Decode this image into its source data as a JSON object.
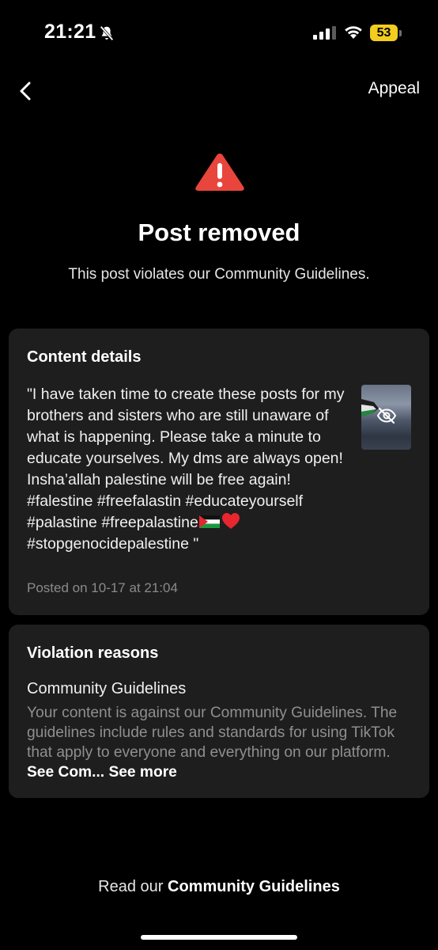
{
  "status_bar": {
    "time": "21:21",
    "battery_level": "53",
    "battery_color": "#f2cc1f"
  },
  "nav": {
    "back_icon": "chevron-left-icon",
    "appeal_label": "Appeal"
  },
  "header": {
    "icon": "warning-triangle-icon",
    "icon_color": "#e8453c",
    "title": "Post removed",
    "subtitle": "This post violates our Community Guidelines."
  },
  "content_details": {
    "title": "Content details",
    "post_text": "\"I have taken time to create these posts for my brothers and sisters who are still unaware of what is happening. Please take a minute to educate yourselves. My dms are always open! Insha’allah palestine will be free again! #falestine #freefalastin #educateyourself #palastine #freepalastine",
    "post_text_end": "#stopgenocidepalestine \"",
    "emojis": [
      "palestine-flag-icon",
      "red-heart-icon"
    ],
    "posted_on": "Posted on 10-17 at 21:04",
    "thumbnail_icon": "eye-slash-icon"
  },
  "violation": {
    "title": "Violation reasons",
    "reason_name": "Community Guidelines",
    "reason_desc": "Your content is against our Community Guidelines. The guidelines include rules and standards for using TikTok that apply to everyone and everything on our platform.",
    "truncated_link": "See Com...",
    "see_more_label": "See more"
  },
  "footer": {
    "prefix": "Read our",
    "link": "Community Guidelines"
  }
}
